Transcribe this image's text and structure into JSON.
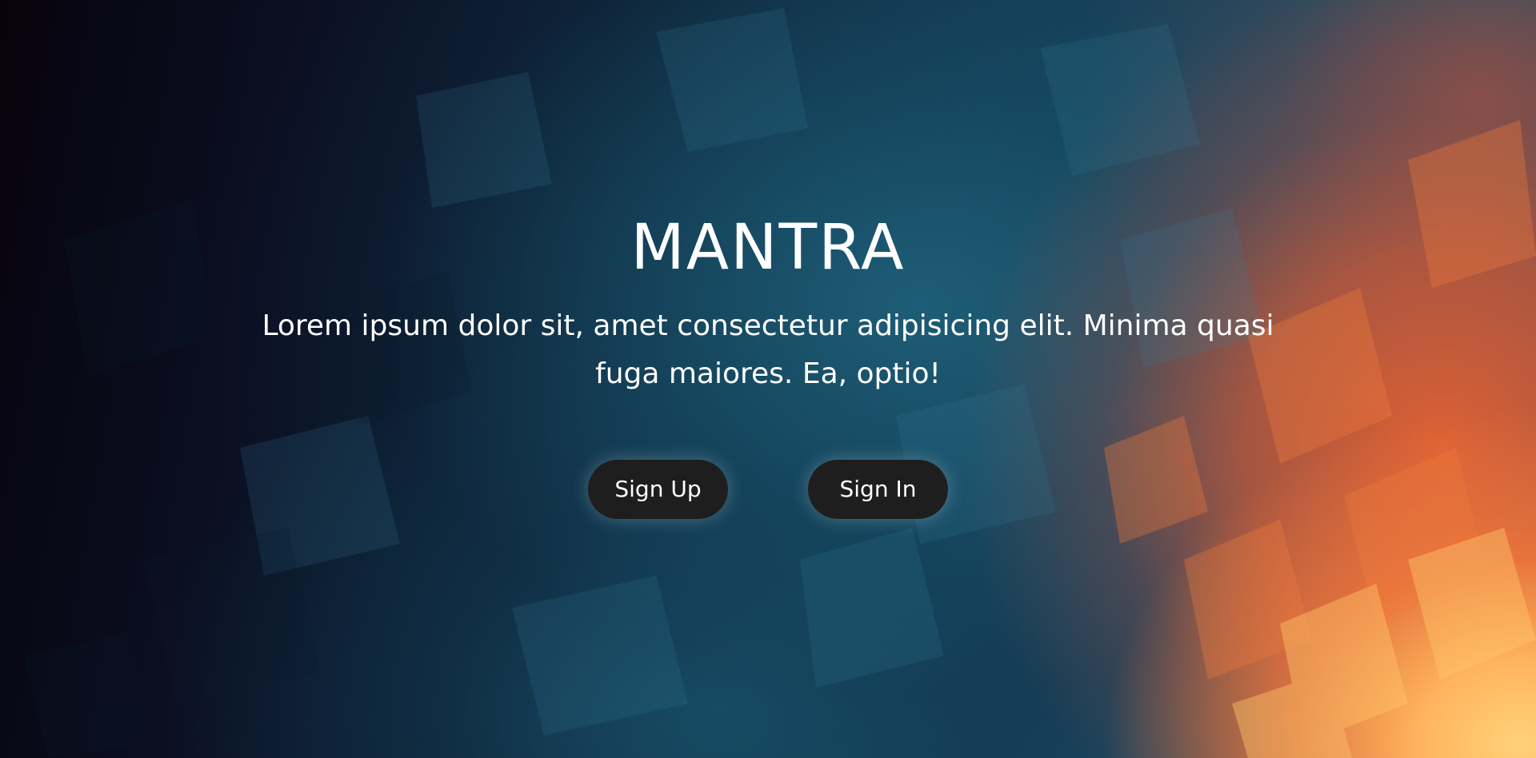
{
  "hero": {
    "title": "MANTRA",
    "subtitle": "Lorem ipsum dolor sit, amet consectetur adipisicing elit. Minima quasi fuga maiores. Ea, optio!",
    "buttons": {
      "signup_label": "Sign Up",
      "signin_label": "Sign In"
    }
  },
  "colors": {
    "button_background": "#1e1e1e",
    "text": "#ffffff",
    "background_dark": "#07030c",
    "background_teal": "#1c4a62",
    "background_orange": "#e86232",
    "background_yellow": "#ffd27a"
  }
}
